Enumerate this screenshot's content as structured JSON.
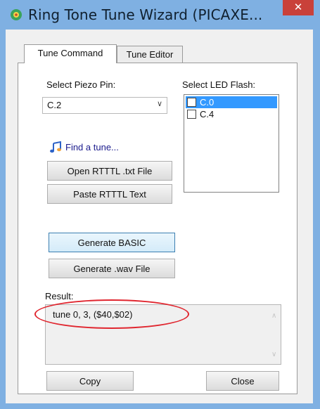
{
  "window": {
    "title": "Ring Tone Tune Wizard (PICAXE..."
  },
  "tabs": [
    {
      "label": "Tune Command",
      "active": true
    },
    {
      "label": "Tune Editor",
      "active": false
    }
  ],
  "piezo": {
    "label": "Select Piezo Pin:",
    "value": "C.2"
  },
  "led": {
    "label": "Select LED Flash:",
    "items": [
      {
        "label": "C.0",
        "selected": true,
        "checked": false
      },
      {
        "label": "C.4",
        "selected": false,
        "checked": false
      }
    ]
  },
  "find_tune": "Find a tune...",
  "buttons": {
    "open": "Open RTTTL .txt File",
    "paste": "Paste RTTTL Text",
    "generate_basic": "Generate BASIC",
    "generate_wav": "Generate .wav File",
    "copy": "Copy",
    "close": "Close"
  },
  "result": {
    "label": "Result:",
    "text": "tune 0, 3, ($40,$02)"
  },
  "colors": {
    "titlebar": "#7fb0e2",
    "close": "#c9413a",
    "selection": "#3399ff",
    "highlight": "#e0262f"
  }
}
